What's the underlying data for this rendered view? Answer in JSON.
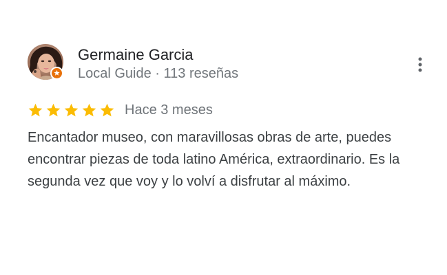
{
  "reviewer": {
    "name": "Germaine Garcia",
    "meta": "Local Guide · 113 reseñas",
    "avatar_icon": "user-photo",
    "badge_icon": "local-guide-badge-icon",
    "badge_color": "#e8710a"
  },
  "review": {
    "rating": 5,
    "rating_max": 5,
    "star_color": "#fbbc04",
    "date": "Hace 3 meses",
    "text": "Encantador museo, con maravillosas obras de arte, puedes encontrar piezas de toda latino América, extraordinario. Es la segunda vez que voy y lo volví a disfrutar al máximo."
  },
  "actions": {
    "more_icon": "more-vert-icon"
  }
}
